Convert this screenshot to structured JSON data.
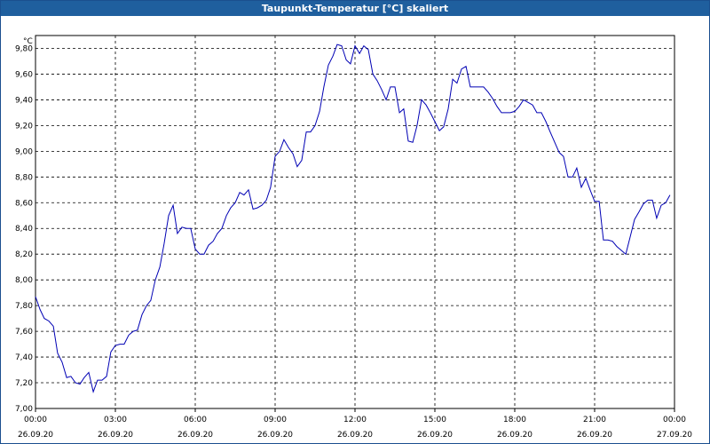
{
  "window": {
    "title": "Taupunkt-Temperatur [°C] skaliert"
  },
  "chart_data": {
    "type": "line",
    "title": "Taupunkt-Temperatur [°C] skaliert",
    "ylabel": "°C",
    "xlabel": "",
    "ylim": [
      7.0,
      9.9
    ],
    "yticks": [
      "7,00",
      "7,20",
      "7,40",
      "7,60",
      "7,80",
      "8,00",
      "8,20",
      "8,40",
      "8,60",
      "8,80",
      "9,00",
      "9,20",
      "9,40",
      "9,60",
      "9,80"
    ],
    "yticks_values": [
      7.0,
      7.2,
      7.4,
      7.6,
      7.8,
      8.0,
      8.2,
      8.4,
      8.6,
      8.8,
      9.0,
      9.2,
      9.4,
      9.6,
      9.8
    ],
    "xlim_hours": [
      0,
      24
    ],
    "xticks": [
      {
        "time": "00:00",
        "date": "26.09.20",
        "hour": 0
      },
      {
        "time": "03:00",
        "date": "26.09.20",
        "hour": 3
      },
      {
        "time": "06:00",
        "date": "26.09.20",
        "hour": 6
      },
      {
        "time": "09:00",
        "date": "26.09.20",
        "hour": 9
      },
      {
        "time": "12:00",
        "date": "26.09.20",
        "hour": 12
      },
      {
        "time": "15:00",
        "date": "26.09.20",
        "hour": 15
      },
      {
        "time": "18:00",
        "date": "26.09.20",
        "hour": 18
      },
      {
        "time": "21:00",
        "date": "26.09.20",
        "hour": 21
      },
      {
        "time": "00:00",
        "date": "27.09.20",
        "hour": 24
      }
    ],
    "grid": true,
    "colors": {
      "line": "#0000b4",
      "grid": "#000000",
      "title_bar": "#1f5f9e"
    },
    "series": [
      {
        "x": [
          0,
          0.17,
          0.33,
          0.5,
          0.67,
          0.83,
          1.0,
          1.17,
          1.33,
          1.5,
          1.67,
          1.83,
          2.0,
          2.17,
          2.33,
          2.5,
          2.67,
          2.83,
          3.0,
          3.17,
          3.33,
          3.5,
          3.67,
          3.83,
          4.0,
          4.17,
          4.33,
          4.5,
          4.67,
          4.83,
          5.0,
          5.17,
          5.33,
          5.5,
          5.67,
          5.83,
          6.0,
          6.17,
          6.33,
          6.5,
          6.67,
          6.83,
          7.0,
          7.17,
          7.33,
          7.5,
          7.67,
          7.83,
          8.0,
          8.17,
          8.33,
          8.5,
          8.67,
          8.83,
          9.0,
          9.17,
          9.33,
          9.5,
          9.67,
          9.83,
          10.0,
          10.17,
          10.33,
          10.5,
          10.67,
          10.83,
          11.0,
          11.17,
          11.33,
          11.5,
          11.67,
          11.83,
          12.0,
          12.17,
          12.33,
          12.5,
          12.67,
          12.83,
          13.0,
          13.17,
          13.33,
          13.5,
          13.67,
          13.83,
          14.0,
          14.17,
          14.33,
          14.5,
          14.67,
          14.83,
          15.0,
          15.17,
          15.33,
          15.5,
          15.67,
          15.83,
          16.0,
          16.17,
          16.33,
          16.5,
          16.67,
          16.83,
          17.0,
          17.17,
          17.33,
          17.5,
          17.67,
          17.83,
          18.0,
          18.17,
          18.33,
          18.5,
          18.67,
          18.83,
          19.0,
          19.17,
          19.33,
          19.5,
          19.67,
          19.83,
          20.0,
          20.17,
          20.33,
          20.5,
          20.67,
          20.83,
          21.0,
          21.17,
          21.33,
          21.5,
          21.67,
          21.83,
          22.0,
          22.17,
          22.33,
          22.5,
          22.67,
          22.83,
          23.0,
          23.17,
          23.33,
          23.5,
          23.67,
          23.83
        ],
        "values": [
          7.87,
          7.77,
          7.7,
          7.68,
          7.64,
          7.43,
          7.36,
          7.24,
          7.25,
          7.2,
          7.19,
          7.24,
          7.28,
          7.13,
          7.22,
          7.22,
          7.25,
          7.44,
          7.49,
          7.5,
          7.5,
          7.57,
          7.6,
          7.61,
          7.73,
          7.8,
          7.84,
          8.0,
          8.1,
          8.28,
          8.5,
          8.58,
          8.36,
          8.41,
          8.4,
          8.4,
          8.24,
          8.2,
          8.2,
          8.27,
          8.3,
          8.36,
          8.4,
          8.5,
          8.56,
          8.6,
          8.68,
          8.66,
          8.7,
          8.55,
          8.56,
          8.58,
          8.62,
          8.72,
          8.96,
          9.0,
          9.09,
          9.03,
          8.98,
          8.88,
          8.93,
          9.15,
          9.15,
          9.2,
          9.31,
          9.5,
          9.67,
          9.74,
          9.83,
          9.82,
          9.71,
          9.68,
          9.82,
          9.76,
          9.82,
          9.79,
          9.6,
          9.55,
          9.48,
          9.4,
          9.5,
          9.5,
          9.3,
          9.33,
          9.08,
          9.07,
          9.2,
          9.4,
          9.36,
          9.3,
          9.23,
          9.16,
          9.19,
          9.33,
          9.56,
          9.53,
          9.64,
          9.66,
          9.5,
          9.5,
          9.5,
          9.5,
          9.46,
          9.41,
          9.35,
          9.3,
          9.3,
          9.3,
          9.31,
          9.35,
          9.4,
          9.38,
          9.36,
          9.3,
          9.3,
          9.23,
          9.15,
          9.07,
          8.99,
          8.96,
          8.8,
          8.8,
          8.87,
          8.72,
          8.79,
          8.7,
          8.61,
          8.61,
          8.31,
          8.31,
          8.3,
          8.26,
          8.23,
          8.2,
          8.33,
          8.47,
          8.53,
          8.59,
          8.62,
          8.62,
          8.48,
          8.58,
          8.6,
          8.66
        ]
      }
    ]
  }
}
